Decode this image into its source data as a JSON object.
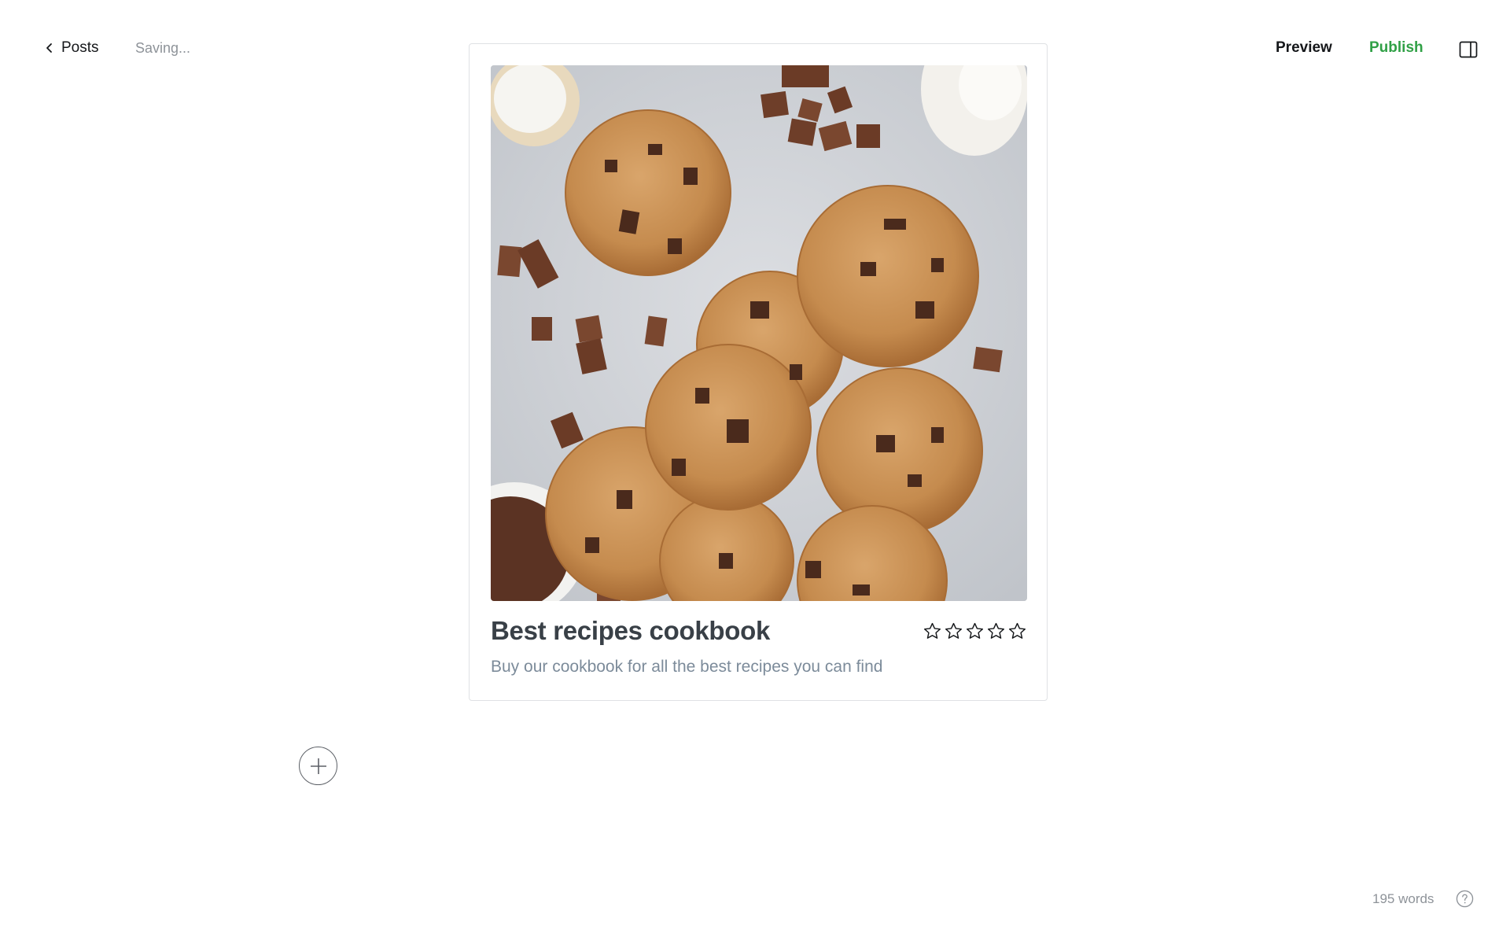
{
  "header": {
    "back_label": "Posts",
    "status": "Saving...",
    "preview_label": "Preview",
    "publish_label": "Publish",
    "publish_color": "#30a046"
  },
  "product_card": {
    "image_alt": "Chocolate chunk cookies on a grey surface with flour, chocolate pieces and a bottle of milk",
    "title": "Best recipes cookbook",
    "description": "Buy our cookbook for all the best recipes you can find",
    "rating": 0,
    "rating_max": 5
  },
  "footer": {
    "word_count": "195 words"
  },
  "icons": {
    "back": "chevron-left-icon",
    "sidebar": "sidebar-toggle-icon",
    "star": "star-outline-icon",
    "add": "plus-icon",
    "help": "help-icon"
  }
}
